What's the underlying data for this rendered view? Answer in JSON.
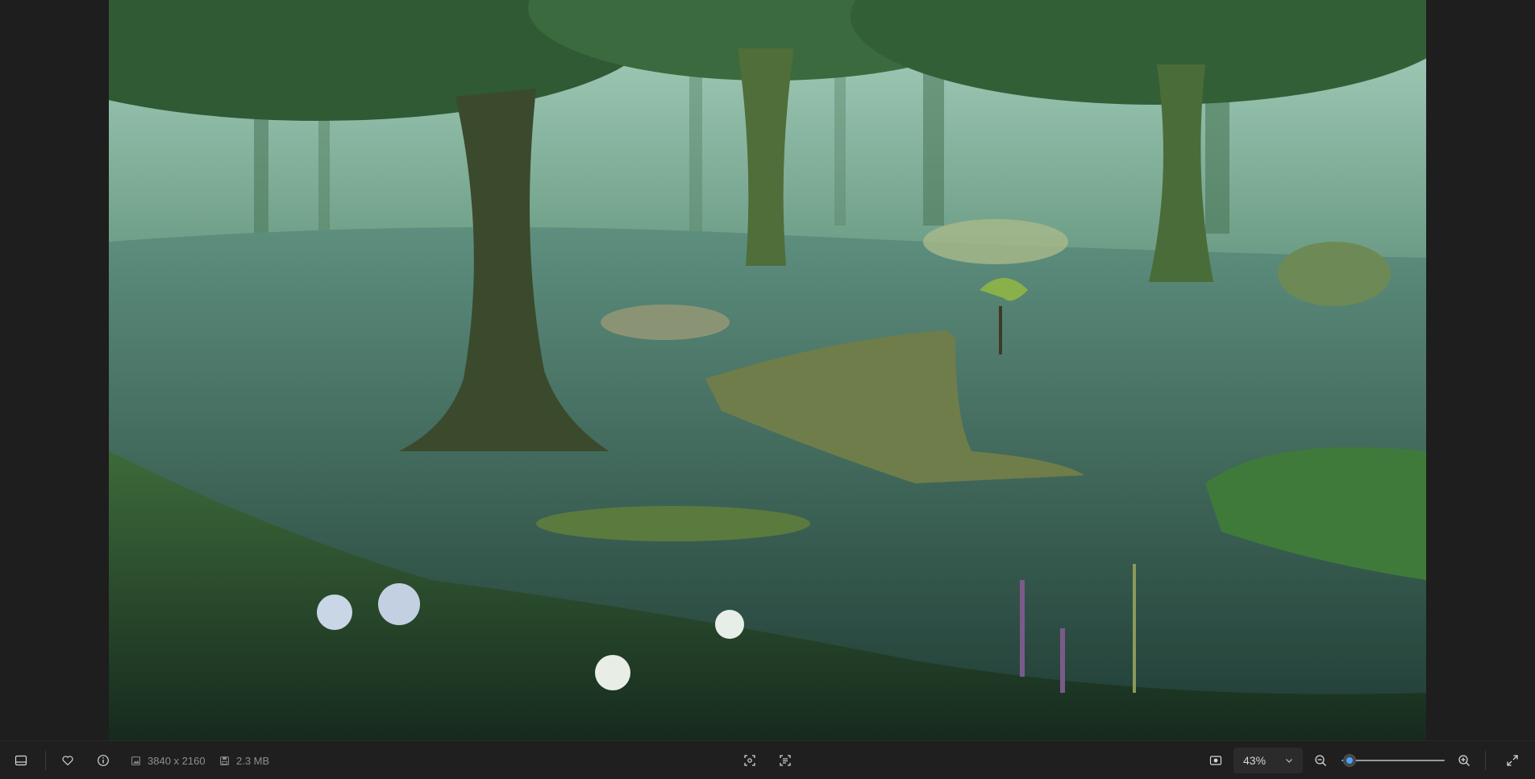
{
  "toolbar": {
    "filmstrip_icon": "filmstrip-icon",
    "favorite_icon": "heart-icon",
    "info_icon": "info-icon",
    "dimensions": "3840 x 2160",
    "file_size": "2.3 MB",
    "zoom_value": "43%",
    "zoom_level_fraction": 0.08,
    "accent_color": "#4aa3ff"
  }
}
